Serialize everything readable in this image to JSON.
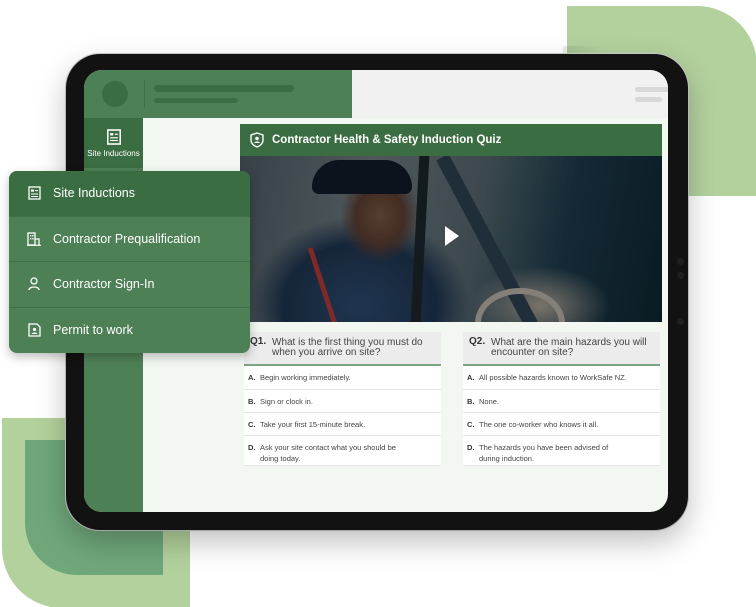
{
  "sidebar": {
    "active_tab_label": "Site Inductions"
  },
  "menu": {
    "items": [
      {
        "label": "Site Inductions",
        "icon": "document-list-icon",
        "active": true
      },
      {
        "label": "Contractor Prequalification",
        "icon": "building-icon",
        "active": false
      },
      {
        "label": "Contractor Sign-In",
        "icon": "user-icon",
        "active": false
      },
      {
        "label": "Permit to work",
        "icon": "permit-badge-icon",
        "active": false
      }
    ]
  },
  "quiz": {
    "title": "Contractor Health & Safety Induction Quiz",
    "header_icon": "shield-user-icon",
    "video": {
      "control": "play-icon"
    },
    "questions": [
      {
        "number": "Q1.",
        "text": "What is the first thing you must do when you arrive on site?",
        "answers": [
          {
            "key": "A.",
            "text": "Begin working immediately."
          },
          {
            "key": "B.",
            "text": "Sign or clock in."
          },
          {
            "key": "C.",
            "text": "Take your first 15-minute break."
          },
          {
            "key": "D.",
            "text": "Ask your site contact what you should be doing today."
          }
        ]
      },
      {
        "number": "Q2.",
        "text": "What are the main hazards you will encounter on site?",
        "answers": [
          {
            "key": "A.",
            "text": "All possible hazards known to WorkSafe NZ."
          },
          {
            "key": "B.",
            "text": "None."
          },
          {
            "key": "C.",
            "text": "The one co-worker who knows it all."
          },
          {
            "key": "D.",
            "text": "The hazards you have been advised of during induction."
          }
        ]
      }
    ]
  },
  "colors": {
    "brand_green": "#4e8056",
    "dark_green": "#3b6d42",
    "leaf_light": "#b3d19d",
    "leaf_mid": "#6fa77a"
  }
}
